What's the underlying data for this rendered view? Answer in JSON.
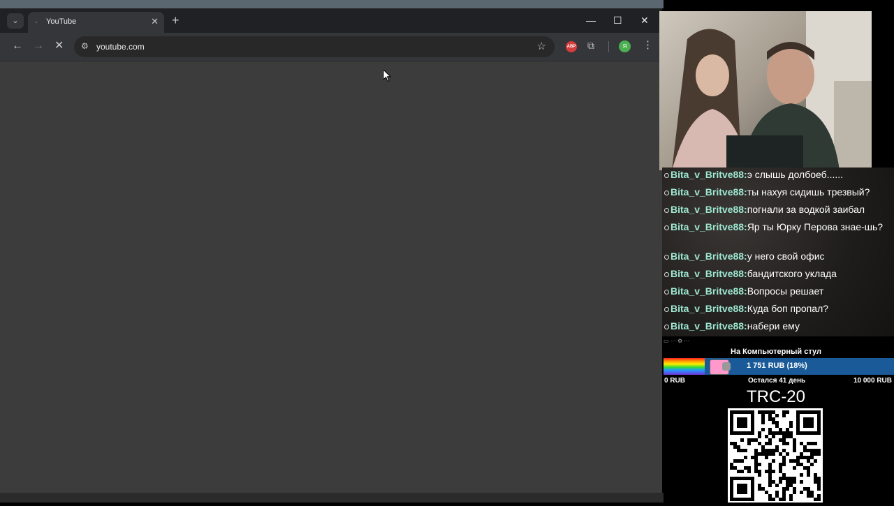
{
  "browser": {
    "tab": {
      "title": "YouTube"
    },
    "address_bar": {
      "url": "youtube.com"
    },
    "profile_initial": "Я",
    "adblock_label": "ABP"
  },
  "stream": {
    "chat": [
      {
        "user": "Bita_v_Britve88:",
        "text": "э слышь долбоеб......"
      },
      {
        "user": "Bita_v_Britve88:",
        "text": "ты нахуя сидишь трезвый?"
      },
      {
        "user": "Bita_v_Britve88:",
        "text": "погнали за водкой заибал"
      },
      {
        "user": "Bita_v_Britve88:",
        "text": "Яр ты Юрку Перова знае-шь?"
      },
      {
        "user": "Bita_v_Britve88:",
        "text": "у него свой офис"
      },
      {
        "user": "Bita_v_Britve88:",
        "text": "бандитского уклада"
      },
      {
        "user": "Bita_v_Britve88:",
        "text": "Вопросы решает"
      },
      {
        "user": "Bita_v_Britve88:",
        "text": "Куда боп пропал?"
      },
      {
        "user": "Bita_v_Britve88:",
        "text": "набери ему"
      }
    ],
    "donation_goal": {
      "title": "На Компьютерный стул",
      "amount": "1 751 RUB (18%)",
      "progress": 0.18,
      "min": "0 RUB",
      "days_left": "Остался 41 день",
      "max": "10 000 RUB"
    },
    "crypto_label": "TRC-20"
  }
}
